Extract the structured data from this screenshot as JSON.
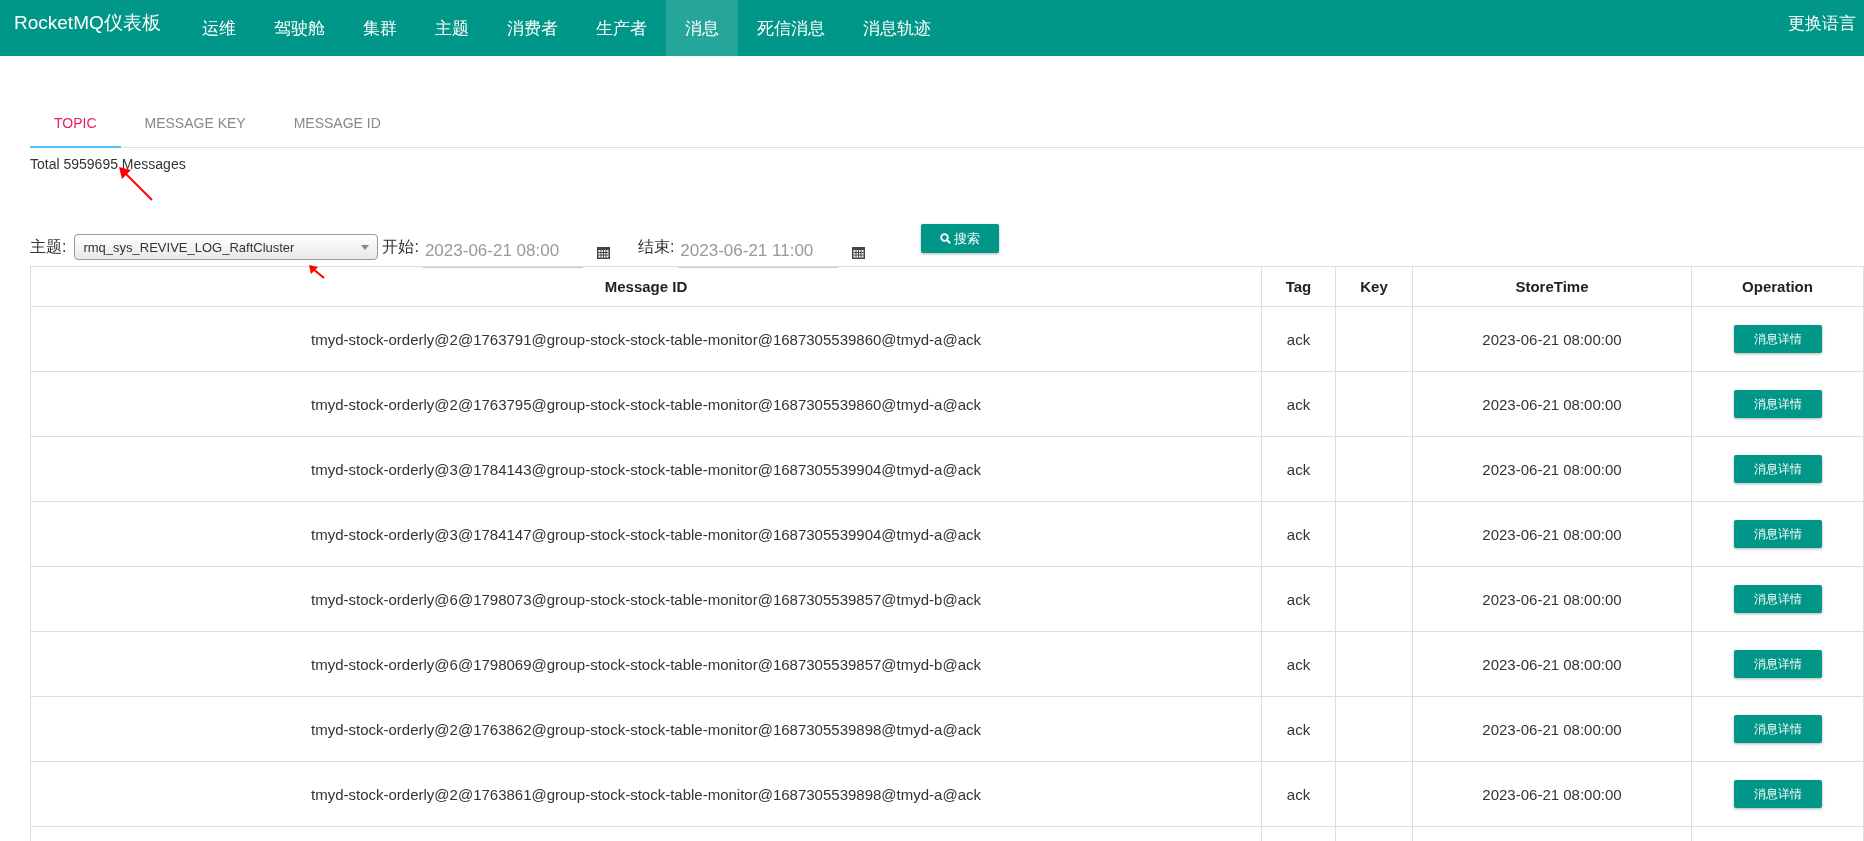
{
  "navbar": {
    "brand": "RocketMQ仪表板",
    "items": [
      {
        "label": "运维",
        "selected": false
      },
      {
        "label": "驾驶舱",
        "selected": false
      },
      {
        "label": "集群",
        "selected": false
      },
      {
        "label": "主题",
        "selected": false
      },
      {
        "label": "消费者",
        "selected": false
      },
      {
        "label": "生产者",
        "selected": false
      },
      {
        "label": "消息",
        "selected": true
      },
      {
        "label": "死信消息",
        "selected": false
      },
      {
        "label": "消息轨迹",
        "selected": false
      }
    ],
    "language": "更换语言"
  },
  "tabs": [
    {
      "label": "TOPIC",
      "selected": true
    },
    {
      "label": "MESSAGE KEY",
      "selected": false
    },
    {
      "label": "MESSAGE ID",
      "selected": false
    }
  ],
  "total": "Total 5959695 Messages",
  "filters": {
    "topic_label": "主题:",
    "topic_value": "rmq_sys_REVIVE_LOG_RaftCluster",
    "start_label": "开始:",
    "start_value": "2023-06-21 08:00",
    "end_label": "结束:",
    "end_value": "2023-06-21 11:00",
    "search_button": "搜索"
  },
  "table": {
    "columns": [
      "Message ID",
      "Tag",
      "Key",
      "StoreTime",
      "Operation"
    ],
    "rows": [
      {
        "message_id": "tmyd-stock-orderly@2@1763791@group-stock-stock-table-monitor@1687305539860@tmyd-a@ack",
        "tag": "ack",
        "store_time": "2023-06-21 08:00:00",
        "action": "消息详情"
      },
      {
        "message_id": "tmyd-stock-orderly@2@1763795@group-stock-stock-table-monitor@1687305539860@tmyd-a@ack",
        "tag": "ack",
        "store_time": "2023-06-21 08:00:00",
        "action": "消息详情"
      },
      {
        "message_id": "tmyd-stock-orderly@3@1784143@group-stock-stock-table-monitor@1687305539904@tmyd-a@ack",
        "tag": "ack",
        "store_time": "2023-06-21 08:00:00",
        "action": "消息详情"
      },
      {
        "message_id": "tmyd-stock-orderly@3@1784147@group-stock-stock-table-monitor@1687305539904@tmyd-a@ack",
        "tag": "ack",
        "store_time": "2023-06-21 08:00:00",
        "action": "消息详情"
      },
      {
        "message_id": "tmyd-stock-orderly@6@1798073@group-stock-stock-table-monitor@1687305539857@tmyd-b@ack",
        "tag": "ack",
        "store_time": "2023-06-21 08:00:00",
        "action": "消息详情"
      },
      {
        "message_id": "tmyd-stock-orderly@6@1798069@group-stock-stock-table-monitor@1687305539857@tmyd-b@ack",
        "tag": "ack",
        "store_time": "2023-06-21 08:00:00",
        "action": "消息详情"
      },
      {
        "message_id": "tmyd-stock-orderly@2@1763862@group-stock-stock-table-monitor@1687305539898@tmyd-a@ack",
        "tag": "ack",
        "store_time": "2023-06-21 08:00:00",
        "action": "消息详情"
      },
      {
        "message_id": "tmyd-stock-orderly@2@1763861@group-stock-stock-table-monitor@1687305539898@tmyd-a@ack",
        "tag": "ack",
        "store_time": "2023-06-21 08:00:00",
        "action": "消息详情"
      }
    ]
  }
}
